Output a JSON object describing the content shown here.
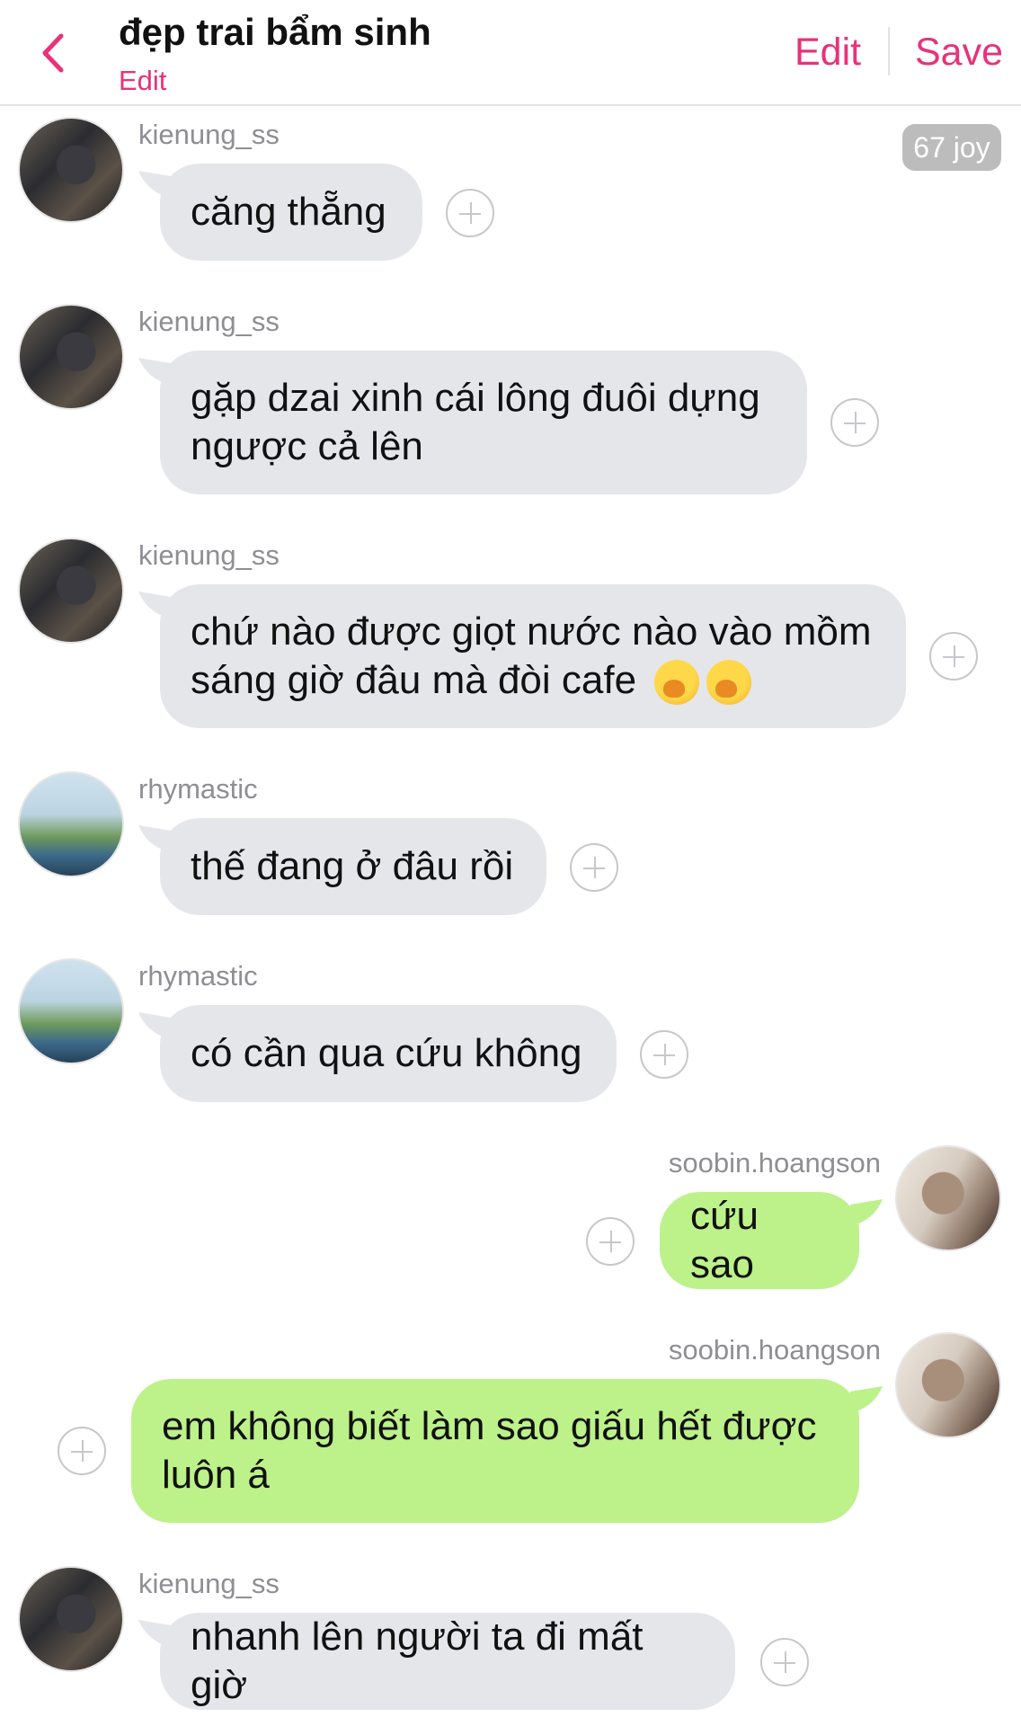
{
  "header": {
    "title": "đẹp trai bẩm sinh",
    "subtitle": "Edit",
    "edit_label": "Edit",
    "save_label": "Save",
    "back_icon": "chevron-left-icon"
  },
  "joy_badge": "67 joy",
  "colors": {
    "accent": "#e8327a",
    "incoming_bubble": "#e5e6ea",
    "outgoing_bubble": "#bdf18a",
    "username": "#8e8e93"
  },
  "messages": [
    {
      "user": "kienung_ss",
      "text": "căng thẵng",
      "direction": "incoming"
    },
    {
      "user": "kienung_ss",
      "text": "gặp dzai xinh cái lông đuôi dựng ngược cả lên",
      "direction": "incoming"
    },
    {
      "user": "kienung_ss",
      "text": "chứ nào được giọt nước nào vào mồm sáng giờ đâu mà đòi cafe",
      "emoji": [
        "yawning-face-icon",
        "yawning-face-icon"
      ],
      "direction": "incoming"
    },
    {
      "user": "rhymastic",
      "text": "thế đang ở đâu rồi",
      "direction": "incoming"
    },
    {
      "user": "rhymastic",
      "text": "có cần qua cứu không",
      "direction": "incoming"
    },
    {
      "user": "soobin.hoangson",
      "text": "cứu sao",
      "direction": "outgoing"
    },
    {
      "user": "soobin.hoangson",
      "text": "em không biết làm sao giấu hết được luôn á",
      "direction": "outgoing"
    },
    {
      "user": "kienung_ss",
      "text": "nhanh lên người ta đi mất giờ",
      "direction": "incoming"
    }
  ]
}
